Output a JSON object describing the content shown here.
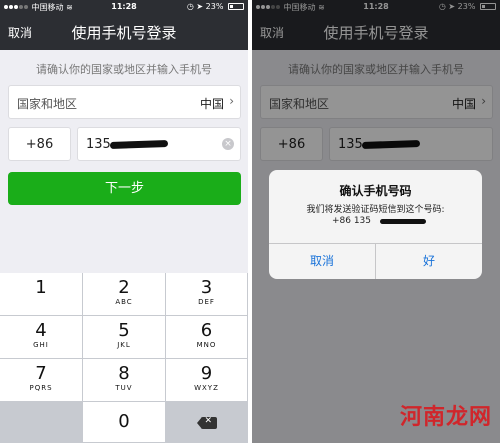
{
  "status": {
    "carrier": "中国移动",
    "time": "11:28",
    "battery": "23%"
  },
  "nav": {
    "cancel": "取消",
    "title": "使用手机号登录"
  },
  "prompt": "请确认你的国家或地区并输入手机号",
  "country": {
    "label": "国家和地区",
    "value": "中国"
  },
  "phone": {
    "code": "+86",
    "number_prefix": "135"
  },
  "next_button": "下一步",
  "keypad": {
    "keys": [
      {
        "digit": "1",
        "letters": ""
      },
      {
        "digit": "2",
        "letters": "ABC"
      },
      {
        "digit": "3",
        "letters": "DEF"
      },
      {
        "digit": "4",
        "letters": "GHI"
      },
      {
        "digit": "5",
        "letters": "JKL"
      },
      {
        "digit": "6",
        "letters": "MNO"
      },
      {
        "digit": "7",
        "letters": "PQRS"
      },
      {
        "digit": "8",
        "letters": "TUV"
      },
      {
        "digit": "9",
        "letters": "WXYZ"
      },
      {
        "digit": "0",
        "letters": ""
      }
    ]
  },
  "dialog": {
    "title": "确认手机号码",
    "message": "我们将发送验证码短信到这个号码:",
    "number": "+86 135",
    "cancel": "取消",
    "ok": "好"
  },
  "watermark": "河南龙网",
  "colors": {
    "nav_bg": "#2c2e33",
    "primary_green": "#1aad19",
    "dialog_link": "#1a73d9"
  }
}
